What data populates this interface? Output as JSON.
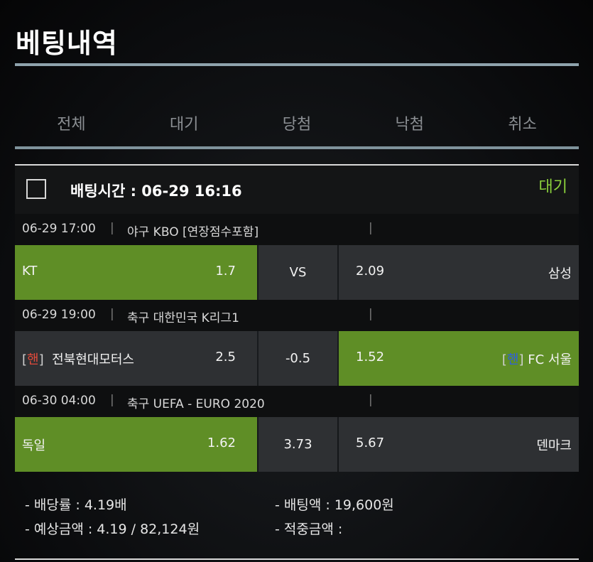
{
  "page": {
    "title": "베팅내역"
  },
  "tabs": [
    {
      "label": "전체"
    },
    {
      "label": "대기"
    },
    {
      "label": "당첨"
    },
    {
      "label": "낙첨"
    },
    {
      "label": "취소"
    }
  ],
  "bet": {
    "time_label": "배팅시간 : 06-29 16:16",
    "status": "대기",
    "status_color": "#8bd13c",
    "matches": [
      {
        "date": "06-29 17:00",
        "league": "야구 KBO [연장점수포함]",
        "home": {
          "name": "KT",
          "odd": "1.7",
          "selected": true
        },
        "mid": "VS",
        "away": {
          "name": "삼성",
          "odd": "2.09",
          "selected": false
        }
      },
      {
        "date": "06-29 19:00",
        "league": "축구 대한민국 K리그1",
        "home": {
          "prefix_open": "[",
          "handicap": "핸",
          "prefix_close": "]",
          "name": "전북현대모터스",
          "odd": "2.5",
          "selected": false
        },
        "mid": "-0.5",
        "away": {
          "prefix_open": "[",
          "handicap": "핸",
          "prefix_close": "]",
          "name": "FC 서울",
          "odd": "1.52",
          "selected": true
        }
      },
      {
        "date": "06-30 04:00",
        "league": "축구 UEFA - EURO 2020",
        "home": {
          "name": "독일",
          "odd": "1.62",
          "selected": true
        },
        "mid": "3.73",
        "away": {
          "name": "덴마크",
          "odd": "5.67",
          "selected": false
        }
      }
    ],
    "summary": {
      "payout_rate": "- 배당률 : 4.19배",
      "bet_amount": "- 배팅액 : 19,600원",
      "expected_amount": "- 예상금액 : 4.19 / 82,124원",
      "win_amount": "- 적중금액 :"
    }
  },
  "colors": {
    "selected": "#5f8e26",
    "unselected": "#2e3033",
    "handicap_home": "#e24a3b",
    "handicap_away": "#2f5fe0"
  }
}
